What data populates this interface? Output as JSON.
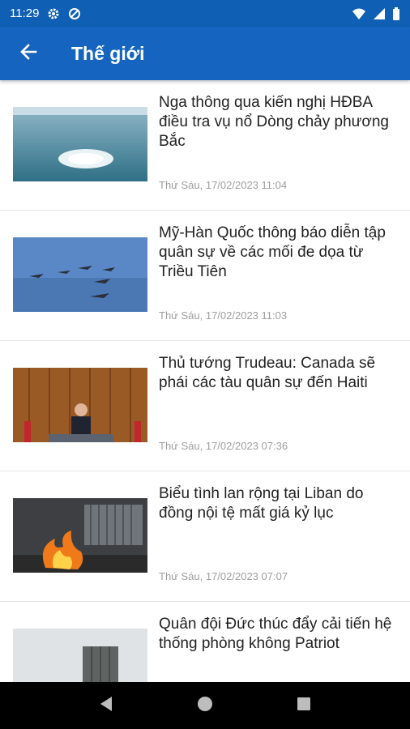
{
  "status_bar": {
    "time": "11:29",
    "icons": [
      "gear-icon",
      "data-saver-icon",
      "wifi-icon",
      "signal-icon",
      "battery-icon"
    ]
  },
  "app_bar": {
    "title": "Thế giới",
    "back_icon": "arrow-left-icon"
  },
  "articles": [
    {
      "title": "Nga thông qua kiến nghị HĐBA điều tra vụ nổ Dòng chảy phương Bắc",
      "date": "Thứ Sáu, 17/02/2023 11:04",
      "thumbnail": "sea-explosion"
    },
    {
      "title": "Mỹ-Hàn Quốc thông báo diễn tập quân sự về các mối đe dọa từ Triều Tiên",
      "date": "Thứ Sáu, 17/02/2023 11:03",
      "thumbnail": "jets-formation"
    },
    {
      "title": "Thủ tướng Trudeau: Canada sẽ phái các tàu quân sự đến Haiti",
      "date": "Thứ Sáu, 17/02/2023 07:36",
      "thumbnail": "podium-speech"
    },
    {
      "title": "Biểu tình lan rộng tại Liban do đồng nội tệ mất giá kỷ lục",
      "date": "Thứ Sáu, 17/02/2023 07:07",
      "thumbnail": "street-fire"
    },
    {
      "title": "Quân đội Đức thúc đẩy cải tiến hệ thống phòng không Patriot",
      "date": "",
      "thumbnail": "missile-launcher"
    }
  ],
  "colors": {
    "app_bar": "#1565c0",
    "status_bar": "#0f5fb5",
    "nav_bar": "#000000"
  },
  "nav_bar": {
    "icons": [
      "back-triangle-icon",
      "home-circle-icon",
      "recents-square-icon"
    ]
  }
}
